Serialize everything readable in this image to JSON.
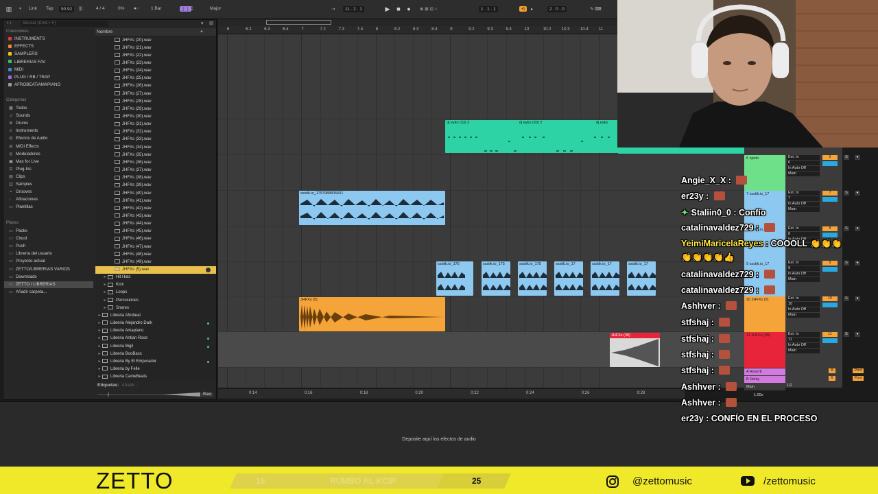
{
  "topbar": {
    "link": "Link",
    "tap": "Tap",
    "tempo": "90.92",
    "sig": "4 / 4",
    "zoom": "0%",
    "quant": "1 Bar",
    "key_root": "C",
    "key_scale": "Major",
    "pos": "11 . 2 . 1",
    "loop_start": "1 . 1 . 1",
    "loop_len": "2 . 0 . 0"
  },
  "browser": {
    "search_placeholder": "Buscar (Cmd + F)",
    "collections_header": "Colecciones",
    "collections": [
      {
        "label": "INSTRUMENTS",
        "color": "#e23b3b"
      },
      {
        "label": "EFFECTS",
        "color": "#f08a2a"
      },
      {
        "label": "SAMPLERS",
        "color": "#e8c32a"
      },
      {
        "label": "LIBRERIAS FAV",
        "color": "#3ac46a"
      },
      {
        "label": "MIDI",
        "color": "#3a8ae0"
      },
      {
        "label": "PLUG / RB / TRAP",
        "color": "#9a6ae0"
      },
      {
        "label": "AFROBEAT/AMAPIANO",
        "color": "#9a9a9a"
      }
    ],
    "categories_header": "Categorías",
    "categories": [
      "Todos",
      "Sounds",
      "Drums",
      "Instruments",
      "Efectos de Audio",
      "MIDI Effects",
      "Moduladores",
      "Max for Live",
      "Plug-Ins",
      "Clips",
      "Samples",
      "Grooves",
      "Afinaciones",
      "Plantillas"
    ],
    "places_header": "Places",
    "places": [
      "Packs",
      "Cloud",
      "Push",
      "Librería del usuario",
      "Proyecto actual",
      "ZETTO/LIBRERIAS VARIOS",
      "Downloads",
      "ZETTO / LIBRERIAS",
      "Añadir carpeta..."
    ],
    "places_selected": 7,
    "name_header": "Nombre",
    "files": [
      "JHFXs (20).wav",
      "JHFXs (21).wav",
      "JHFXs (22).wav",
      "JHFXs (23).wav",
      "JHFXs (24).wav",
      "JHFXs (25).wav",
      "JHFXs (26).wav",
      "JHFXs (27).wav",
      "JHFXs (28).wav",
      "JHFXs (29).wav",
      "JHFXs (30).wav",
      "JHFXs (31).wav",
      "JHFXs (32).wav",
      "JHFXs (33).wav",
      "JHFXs (34).wav",
      "JHFXs (35).wav",
      "JHFXs (36).wav",
      "JHFXs (37).wav",
      "JHFXs (38).wav",
      "JHFXs (39).wav",
      "JHFXs (40).wav",
      "JHFXs (41).wav",
      "JHFXs (42).wav",
      "JHFXs (43).wav",
      "JHFXs (44).wav",
      "JHFXs (45).wav",
      "JHFXs (46).wav",
      "JHFXs (47).wav",
      "JHFXs (48).wav",
      "JHFXs (49).wav",
      "JHFXs (5).wav"
    ],
    "subfolders": [
      "Hit Hats",
      "Kick",
      "Loops",
      "Percusiones",
      "Snares"
    ],
    "libraries": [
      "Libreria Afrobeat",
      "Libreria Alejandro Dark",
      "Libreria Amapiano",
      "Libreria Antian Rose",
      "Libreria Bigil",
      "Libreria BooBass",
      "Libreria By El Emperador",
      "Libreria by Felle",
      "Libreria CameBeats"
    ],
    "tags_label": "Etiquetas:",
    "tags_placeholder": "Añadir...",
    "raw_label": "Raw"
  },
  "ruler": [
    "6",
    "6.2",
    "6.3",
    "6.4",
    "7",
    "7.2",
    "7.3",
    "7.4",
    "8",
    "8.2",
    "8.3",
    "8.4",
    "9",
    "9.2",
    "9.3",
    "9.4",
    "10",
    "10.2",
    "10.3",
    "10.4",
    "11"
  ],
  "timeline": [
    "0:14",
    "0:16",
    "0:18",
    "0:20",
    "0:22",
    "0:24",
    "0:26",
    "0:28"
  ],
  "clips": {
    "dj_1": "dj eyko (33) 2",
    "dj_2": "dj eyko (33) 2",
    "dj_3": "dj eyko",
    "sss": "ssstik.io_1757988805501",
    "chops": [
      "ssstik.io_175",
      "ssstik.io_175",
      "ssstik.io_175",
      "ssstik.io_17",
      "ssstik.io_17",
      "ssstik.io_17"
    ],
    "jhfx": "JHFXs (5)",
    "red": "JHFXs (38)"
  },
  "tracks": [
    {
      "name": "6 njodo",
      "num": "6",
      "color": "#6fe08a"
    },
    {
      "name": "7 ssstik.io_17",
      "num": "7",
      "color": "#8cc8f0"
    },
    {
      "name": "8 ssstik.io_17",
      "num": "8",
      "color": "#8cc8f0"
    },
    {
      "name": "9 ssstik.io_17",
      "num": "9",
      "color": "#8cc8f0"
    },
    {
      "name": "10 JHFXs (5)",
      "num": "10",
      "color": "#f5a43a"
    },
    {
      "name": "11 JHFXs (38)",
      "num": "11",
      "color": "#e8243a"
    }
  ],
  "returns": [
    {
      "name": "A Reverb",
      "letter": "A"
    },
    {
      "name": "B Delay",
      "letter": "B"
    },
    {
      "name": "Main",
      "letter": ""
    }
  ],
  "mixer": {
    "ext_in": "Ext. In",
    "in_auto_off": "In Auto Off",
    "main": "Main",
    "post": "Post",
    "tempo_ratio": "1.00x",
    "half": "1/2"
  },
  "device": {
    "drop_hint": "Deposite aquí los efectos de audio"
  },
  "chat": [
    {
      "user": "Angie_X_X",
      "text": ""
    },
    {
      "user": "er23y",
      "text": ""
    },
    {
      "user": "Staliin0_0",
      "text": "Confío"
    },
    {
      "user": "catalinavaldez729",
      "text": ""
    },
    {
      "user": "YeimiMaricelaReyes",
      "text": "COOOLL"
    },
    {
      "user": "catalinavaldez729",
      "text": ""
    },
    {
      "user": "catalinavaldez729",
      "text": ""
    },
    {
      "user": "Ashhver",
      "text": ""
    },
    {
      "user": "stfshaj",
      "text": ""
    },
    {
      "user": "stfshaj",
      "text": ""
    },
    {
      "user": "stfshaj",
      "text": ""
    },
    {
      "user": "stfshaj",
      "text": ""
    },
    {
      "user": "Ashhver",
      "text": ""
    },
    {
      "user": "Ashhver",
      "text": ""
    },
    {
      "user": "er23y",
      "text": "CONFÍO EN EL PROCESO"
    }
  ],
  "banner": {
    "brand": "ZETTO",
    "goal_current": "19",
    "goal_label": "RUMBO AL KCIP",
    "goal_target": "25",
    "instagram": "@zettomusic",
    "youtube": "/zettomusic"
  },
  "colors": {
    "accent_yellow": "#f0e92a",
    "clip_green": "#2dd3a4",
    "clip_blue": "#8cc8f0",
    "clip_orange": "#f5a43a",
    "clip_red": "#e8243a"
  }
}
